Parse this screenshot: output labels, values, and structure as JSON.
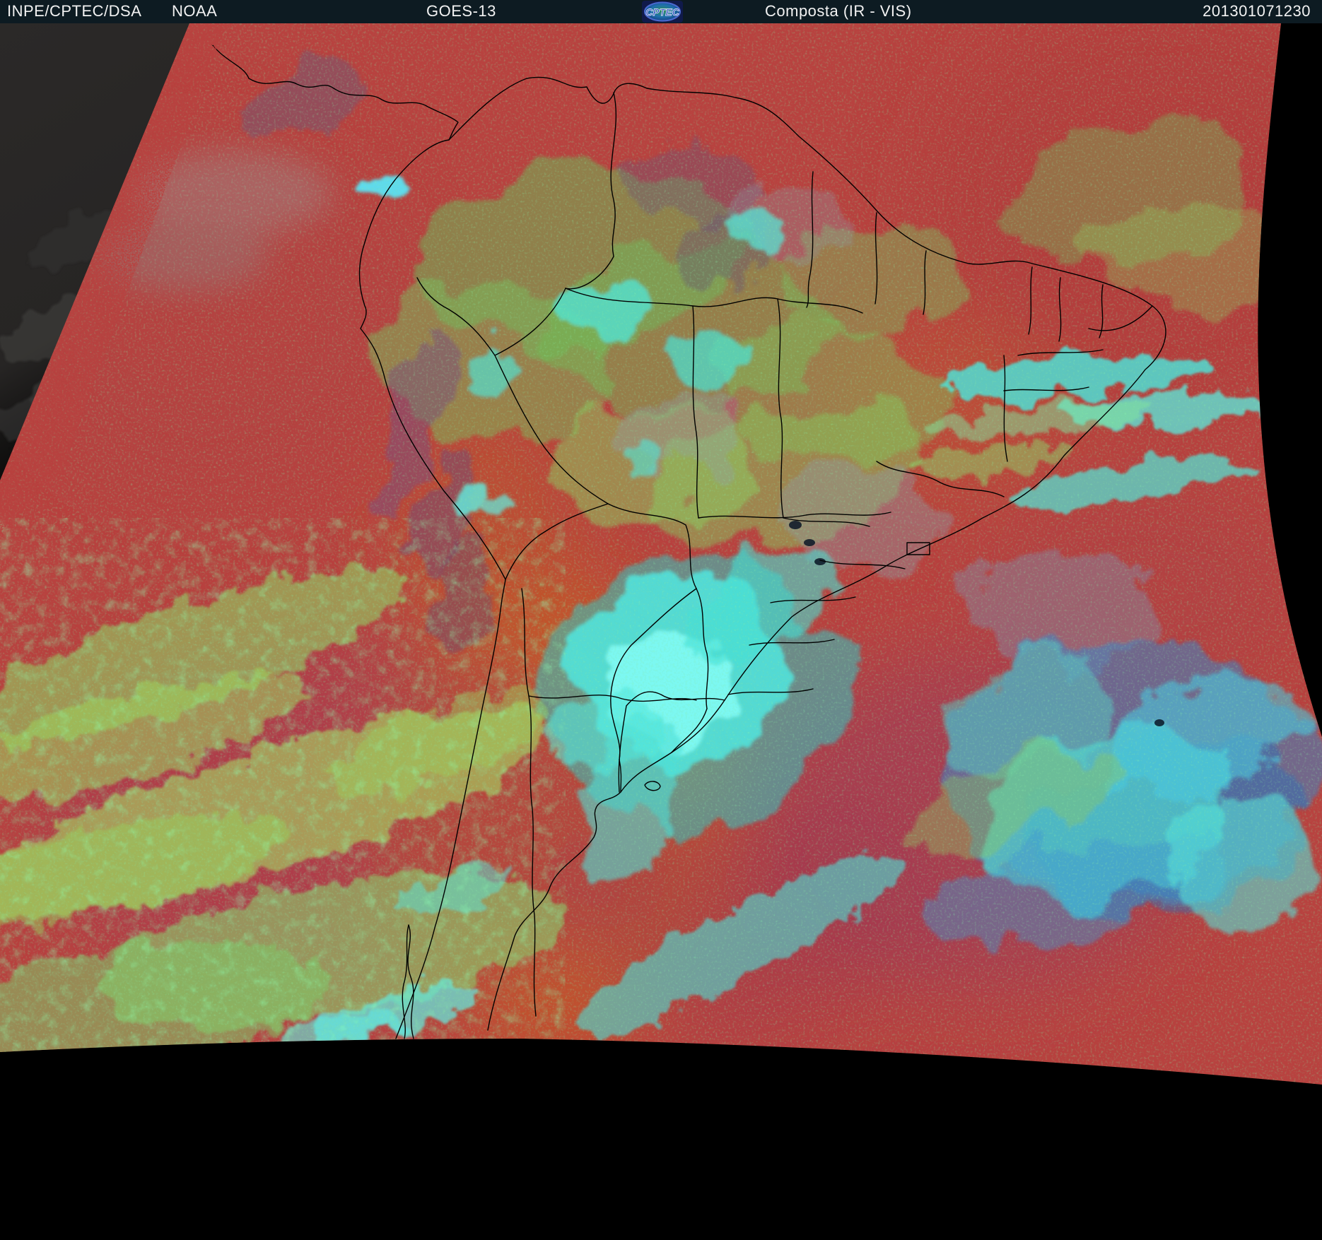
{
  "header": {
    "agency": "INPE/CPTEC/DSA",
    "network": "NOAA",
    "satellite": "GOES-13",
    "logo_text": "CPTEC",
    "product": "Composta (IR - VIS)",
    "timestamp": "201301071230"
  },
  "palette": {
    "header_bg": "#0d1b22",
    "header_text": "#f2f2f2",
    "space_black": "#000000",
    "offscan_gray": "#2b2928",
    "base_red": "#b8423f",
    "deep_magenta": "#a13a56",
    "andes_orange": "#c85c22",
    "cloud_green": "#82c95e",
    "cloud_yellow_green": "#a5da62",
    "cloud_cyan": "#4de8da",
    "storm_cyan": "#7ffaf2",
    "atlantic_blue": "#3a86c8",
    "mountain_purple": "#7a5080",
    "border_black": "#000000"
  }
}
